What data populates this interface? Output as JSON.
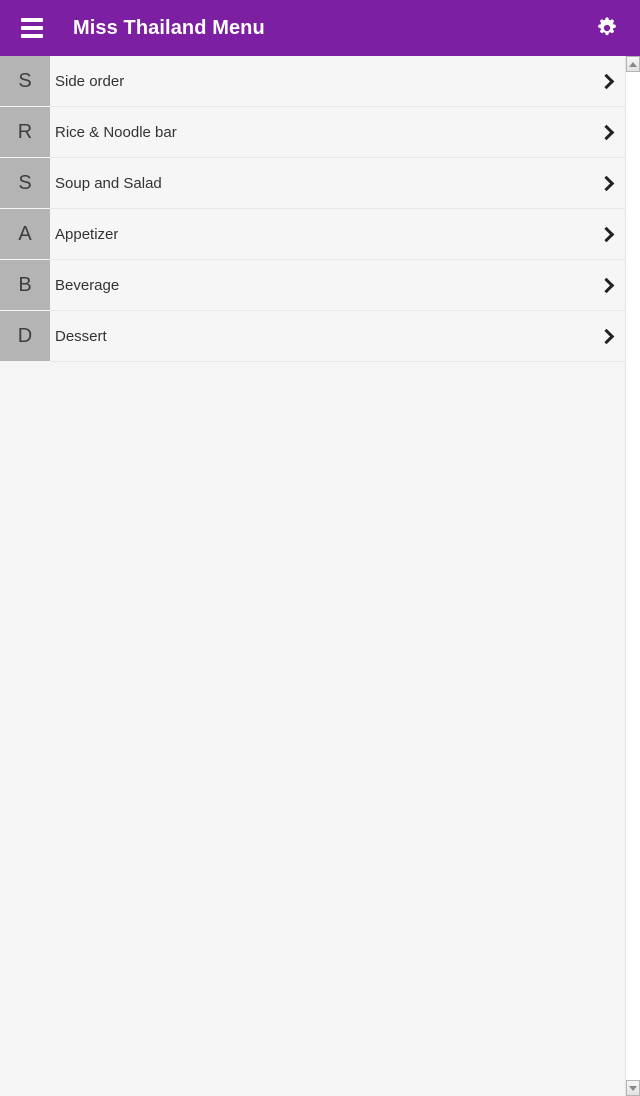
{
  "appbar": {
    "title": "Miss Thailand Menu",
    "menu_icon": "hamburger-menu-icon",
    "settings_icon": "gear-icon",
    "background_color": "#7d1fa3",
    "text_color": "#ffffff"
  },
  "list": {
    "avatar_color": "#b4b4b4",
    "row_background": "#f6f6f6",
    "items": [
      {
        "initial": "S",
        "label": "Side order",
        "chevron": "chevron-right-icon"
      },
      {
        "initial": "R",
        "label": "Rice & Noodle bar",
        "chevron": "chevron-right-icon"
      },
      {
        "initial": "S",
        "label": "Soup and Salad",
        "chevron": "chevron-right-icon"
      },
      {
        "initial": "A",
        "label": "Appetizer",
        "chevron": "chevron-right-icon"
      },
      {
        "initial": "B",
        "label": "Beverage",
        "chevron": "chevron-right-icon"
      },
      {
        "initial": "D",
        "label": "Dessert",
        "chevron": "chevron-right-icon"
      }
    ]
  },
  "scrollbar": {
    "up_arrow": "scroll-up-arrow-icon",
    "down_arrow": "scroll-down-arrow-icon"
  },
  "page": {
    "background_color": "#f5f5f5"
  }
}
